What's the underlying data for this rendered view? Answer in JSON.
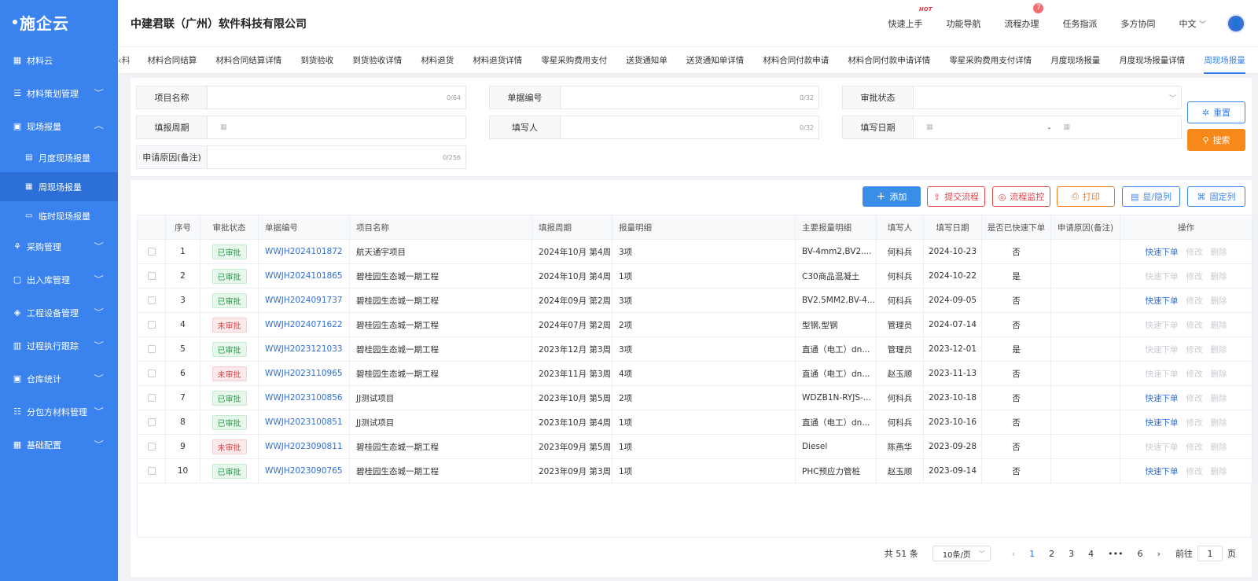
{
  "sidebar": {
    "logo": "施企云",
    "items": [
      {
        "label": "材料云",
        "icon": "grid-icon"
      },
      {
        "label": "材料策划管理",
        "icon": "plan-icon"
      },
      {
        "label": "现场报量",
        "icon": "report-icon",
        "expanded": true
      },
      {
        "label": "月度现场报量",
        "icon": "doc-icon"
      },
      {
        "label": "周现场报量",
        "icon": "calendar-icon"
      },
      {
        "label": "临时现场报量",
        "icon": "card-icon"
      },
      {
        "label": "采购管理",
        "icon": "network-icon"
      },
      {
        "label": "出入库管理",
        "icon": "box-icon"
      },
      {
        "label": "工程设备管理",
        "icon": "cube-icon"
      },
      {
        "label": "过程执行跟踪",
        "icon": "track-icon"
      },
      {
        "label": "仓库统计",
        "icon": "warehouse-icon"
      },
      {
        "label": "分包方材料管理",
        "icon": "subcontract-icon"
      },
      {
        "label": "基础配置",
        "icon": "config-icon"
      }
    ]
  },
  "header": {
    "company": "中建君联（广州）软件科技有限公司",
    "quick_start": "快速上手",
    "hot": "HOT",
    "func_nav": "功能导航",
    "process": "流程办理",
    "process_badge": "7",
    "task": "任务指派",
    "collab": "多方协同",
    "lang": "中文"
  },
  "tabs": [
    "材料合同结算",
    "材料合同结算详情",
    "到货验收",
    "到货验收详情",
    "材料退货",
    "材料退货详情",
    "零星采购费用支付",
    "送货通知单",
    "送货通知单详情",
    "材料合同付款申请",
    "材料合同付款申请详情",
    "零星采购费用支付详情",
    "月度现场报量",
    "月度现场报量详情",
    "周现场报量"
  ],
  "tab_partial": "料",
  "filter": {
    "project_name": {
      "label": "项目名称",
      "count": "0/64"
    },
    "doc_no": {
      "label": "单据编号",
      "count": "0/32"
    },
    "approval": {
      "label": "审批状态"
    },
    "period": {
      "label": "填报周期"
    },
    "filler": {
      "label": "填写人",
      "count": "0/32"
    },
    "fill_date": {
      "label": "填写日期",
      "sep": "-"
    },
    "reason": {
      "label": "申请原因(备注)",
      "count": "0/256"
    },
    "reset": "重置",
    "search": "搜索"
  },
  "toolbar": {
    "add": "添加",
    "submit": "提交流程",
    "monitor": "流程监控",
    "print": "打印",
    "toggle": "显/隐列",
    "fix": "固定列"
  },
  "columns": [
    "序号",
    "审批状态",
    "单据编号",
    "项目名称",
    "填报周期",
    "报量明细",
    "主要报量明细",
    "填写人",
    "填写日期",
    "是否已快速下单",
    "申请原因(备注)",
    "操作"
  ],
  "rows": [
    {
      "no": "1",
      "status": "已审批",
      "ok": true,
      "code": "WWJH2024101872",
      "project": "航天通宇项目",
      "period": "2024年10月 第4周",
      "detail": "3项",
      "main": "BV-4mm2,BV2....",
      "filler": "何科兵",
      "date": "2024-10-23",
      "quick": "否",
      "reason": "",
      "quick_on": true
    },
    {
      "no": "2",
      "status": "已审批",
      "ok": true,
      "code": "WWJH2024101865",
      "project": "碧桂园生态城一期工程",
      "period": "2024年10月 第4周",
      "detail": "1项",
      "main": "C30商品混凝土",
      "filler": "何科兵",
      "date": "2024-10-22",
      "quick": "是",
      "reason": "",
      "quick_on": false
    },
    {
      "no": "3",
      "status": "已审批",
      "ok": true,
      "code": "WWJH2024091737",
      "project": "碧桂园生态城一期工程",
      "period": "2024年09月 第2周",
      "detail": "3项",
      "main": "BV2.5MM2,BV-4...",
      "filler": "何科兵",
      "date": "2024-09-05",
      "quick": "否",
      "reason": "",
      "quick_on": true
    },
    {
      "no": "4",
      "status": "未审批",
      "ok": false,
      "code": "WWJH2024071622",
      "project": "碧桂园生态城一期工程",
      "period": "2024年07月 第2周",
      "detail": "2项",
      "main": "型钢,型钢",
      "filler": "管理员",
      "date": "2024-07-14",
      "quick": "否",
      "reason": "",
      "quick_on": false
    },
    {
      "no": "5",
      "status": "已审批",
      "ok": true,
      "code": "WWJH2023121033",
      "project": "碧桂园生态城一期工程",
      "period": "2023年12月 第3周",
      "detail": "3项",
      "main": "直通（电工）dn...",
      "filler": "管理员",
      "date": "2023-12-01",
      "quick": "是",
      "reason": "",
      "quick_on": false
    },
    {
      "no": "6",
      "status": "未审批",
      "ok": false,
      "code": "WWJH2023110965",
      "project": "碧桂园生态城一期工程",
      "period": "2023年11月 第3周",
      "detail": "4项",
      "main": "直通（电工）dn...",
      "filler": "赵玉顺",
      "date": "2023-11-13",
      "quick": "否",
      "reason": "",
      "quick_on": false
    },
    {
      "no": "7",
      "status": "已审批",
      "ok": true,
      "code": "WWJH2023100856",
      "project": "JJ测试项目",
      "period": "2023年10月 第5周",
      "detail": "2项",
      "main": "WDZB1N-RYJS-...",
      "filler": "何科兵",
      "date": "2023-10-18",
      "quick": "否",
      "reason": "",
      "quick_on": true
    },
    {
      "no": "8",
      "status": "已审批",
      "ok": true,
      "code": "WWJH2023100851",
      "project": "JJ测试项目",
      "period": "2023年10月 第4周",
      "detail": "1项",
      "main": "直通（电工）dn...",
      "filler": "何科兵",
      "date": "2023-10-16",
      "quick": "否",
      "reason": "",
      "quick_on": true
    },
    {
      "no": "9",
      "status": "未审批",
      "ok": false,
      "code": "WWJH2023090811",
      "project": "碧桂园生态城一期工程",
      "period": "2023年09月 第5周",
      "detail": "1项",
      "main": "Diesel",
      "filler": "陈燕华",
      "date": "2023-09-28",
      "quick": "否",
      "reason": "",
      "quick_on": false
    },
    {
      "no": "10",
      "status": "已审批",
      "ok": true,
      "code": "WWJH2023090765",
      "project": "碧桂园生态城一期工程",
      "period": "2023年09月 第3周",
      "detail": "1项",
      "main": "PHC预应力管桩",
      "filler": "赵玉顺",
      "date": "2023-09-14",
      "quick": "否",
      "reason": "",
      "quick_on": true
    }
  ],
  "ops": {
    "quick": "快速下单",
    "edit": "修改",
    "del": "删除"
  },
  "pager": {
    "total": "共 51 条",
    "size": "10条/页",
    "pages": [
      "1",
      "2",
      "3",
      "4",
      "•••",
      "6"
    ],
    "current": "1",
    "goto_pre": "前往",
    "goto_val": "1",
    "goto_post": "页"
  },
  "colors": {
    "sidebar": "#3a82ee",
    "primary": "#3a82ee",
    "search": "#f7891b",
    "danger": "#e0454a"
  }
}
